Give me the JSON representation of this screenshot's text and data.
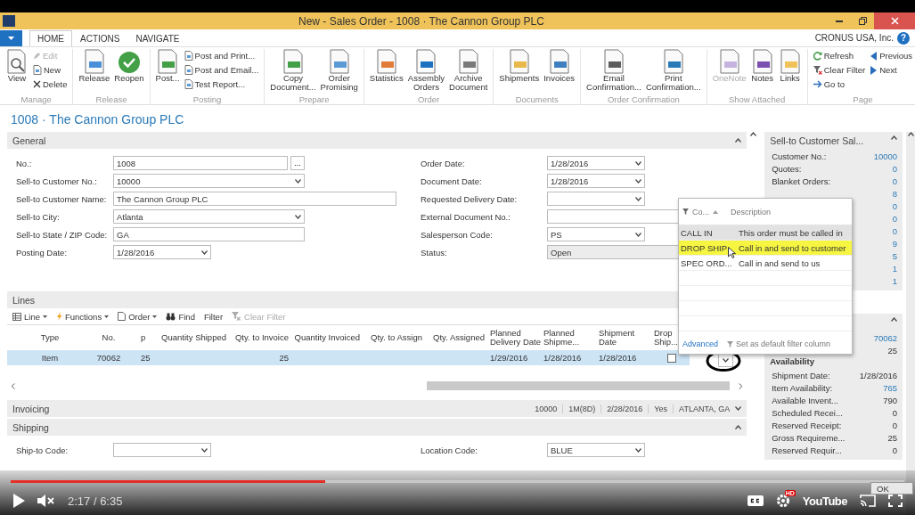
{
  "window": {
    "title": "New - Sales Order - 1008 · The Cannon Group PLC"
  },
  "ribbon": {
    "tabs": [
      {
        "label": "HOME",
        "selected": true
      },
      {
        "label": "ACTIONS",
        "selected": false
      },
      {
        "label": "NAVIGATE",
        "selected": false
      }
    ],
    "company": "CRONUS USA, Inc.",
    "help": "?",
    "groups": [
      {
        "label": "Manage",
        "items": [
          {
            "kind": "large",
            "label": "View",
            "disabled": false
          },
          {
            "kind": "small",
            "label": "Edit",
            "disabled": true
          },
          {
            "kind": "small",
            "label": "New",
            "disabled": false
          },
          {
            "kind": "small",
            "label": "Delete",
            "disabled": false
          }
        ]
      },
      {
        "label": "Release",
        "items": [
          {
            "kind": "large",
            "label": "Release",
            "disabled": false
          },
          {
            "kind": "large",
            "label": "Reopen",
            "disabled": false
          }
        ]
      },
      {
        "label": "Posting",
        "items": [
          {
            "kind": "large",
            "label": "Post...",
            "disabled": false
          },
          {
            "kind": "small",
            "label": "Post and Print...",
            "disabled": false
          },
          {
            "kind": "small",
            "label": "Post and Email...",
            "disabled": false
          },
          {
            "kind": "small",
            "label": "Test Report...",
            "disabled": false
          }
        ]
      },
      {
        "label": "Prepare",
        "items": [
          {
            "kind": "large",
            "label": "Copy\nDocument...",
            "disabled": false
          },
          {
            "kind": "large",
            "label": "Order\nPromising",
            "disabled": false
          }
        ]
      },
      {
        "label": "Order",
        "items": [
          {
            "kind": "large",
            "label": "Statistics",
            "disabled": false
          },
          {
            "kind": "large",
            "label": "Assembly\nOrders",
            "disabled": false
          },
          {
            "kind": "large",
            "label": "Archive\nDocument",
            "disabled": false
          }
        ]
      },
      {
        "label": "Documents",
        "items": [
          {
            "kind": "large",
            "label": "Shipments",
            "disabled": false
          },
          {
            "kind": "large",
            "label": "Invoices",
            "disabled": false
          }
        ]
      },
      {
        "label": "Order Confirmation",
        "items": [
          {
            "kind": "large",
            "label": "Email\nConfirmation...",
            "disabled": false
          },
          {
            "kind": "large",
            "label": "Print\nConfirmation...",
            "disabled": false
          }
        ]
      },
      {
        "label": "Show Attached",
        "items": [
          {
            "kind": "large",
            "label": "OneNote",
            "disabled": true
          },
          {
            "kind": "large",
            "label": "Notes",
            "disabled": false
          },
          {
            "kind": "large",
            "label": "Links",
            "disabled": false
          }
        ]
      },
      {
        "label": "Page",
        "items": [
          {
            "kind": "small",
            "label": "Refresh",
            "disabled": false
          },
          {
            "kind": "small",
            "label": "Clear Filter",
            "disabled": false
          },
          {
            "kind": "small",
            "label": "Go to",
            "disabled": false
          },
          {
            "kind": "small",
            "label": "Previous",
            "disabled": false
          },
          {
            "kind": "small",
            "label": "Next",
            "disabled": false
          }
        ]
      }
    ]
  },
  "page_title": "1008 · The Cannon Group PLC",
  "general": {
    "title": "General",
    "left_fields": [
      {
        "label": "No.:",
        "value": "1008",
        "kind": "lookup",
        "button": "..."
      },
      {
        "label": "Sell-to Customer No.:",
        "value": "10000",
        "kind": "dropdown"
      },
      {
        "label": "Sell-to Customer Name:",
        "value": "The Cannon Group PLC",
        "kind": "wide"
      },
      {
        "label": "Sell-to City:",
        "value": "Atlanta",
        "kind": "dropdown"
      },
      {
        "label": "Sell-to State / ZIP Code:",
        "value": "GA",
        "kind": "text"
      },
      {
        "label": "Posting Date:",
        "value": "1/28/2016",
        "kind": "date"
      }
    ],
    "right_fields": [
      {
        "label": "Order Date:",
        "value": "1/28/2016",
        "kind": "date"
      },
      {
        "label": "Document Date:",
        "value": "1/28/2016",
        "kind": "date"
      },
      {
        "label": "Requested Delivery Date:",
        "kind": "date"
      },
      {
        "label": "External Document No.:",
        "kind": "wide"
      },
      {
        "label": "Salesperson Code:",
        "value": "PS",
        "kind": "date"
      },
      {
        "label": "Status:",
        "value": "Open",
        "kind": "readonly"
      }
    ]
  },
  "lines": {
    "title": "Lines",
    "toolbar": [
      {
        "label": "Line",
        "menu": true,
        "disabled": false
      },
      {
        "label": "Functions",
        "menu": true,
        "disabled": false
      },
      {
        "label": "Order",
        "menu": true,
        "disabled": false
      },
      {
        "label": "Find",
        "menu": false,
        "disabled": false
      },
      {
        "label": "Filter",
        "menu": false,
        "disabled": false
      },
      {
        "label": "Clear Filter",
        "menu": false,
        "disabled": true
      }
    ],
    "columns": [
      {
        "label": "Type",
        "kind": "text"
      },
      {
        "label": "No.",
        "kind": "text"
      },
      {
        "label": "p",
        "kind": "cut"
      },
      {
        "label": "Quantity Shipped",
        "kind": "number"
      },
      {
        "label": "Qty. to Invoice",
        "kind": "number"
      },
      {
        "label": "Quantity Invoiced",
        "kind": "number"
      },
      {
        "label": "Qty. to Assign",
        "kind": "number"
      },
      {
        "label": "Qty. Assigned",
        "kind": "number"
      },
      {
        "label": "Planned Delivery Date",
        "kind": "date"
      },
      {
        "label": "Planned Shipme...",
        "kind": "date"
      },
      {
        "label": "Shipment Date",
        "kind": "date"
      },
      {
        "label": "Drop Ship...",
        "kind": "check"
      }
    ],
    "rows": [
      {
        "selected": true,
        "cells": [
          "Item",
          "70062",
          "25",
          null,
          "25",
          null,
          null,
          null,
          "1/29/2016",
          "1/28/2016",
          "1/28/2016",
          false
        ]
      }
    ]
  },
  "invoicing": {
    "title": "Invoicing",
    "summary": [
      "10000",
      "1M(8D)",
      "2/28/2016",
      "Yes",
      "ATLANTA, GA"
    ]
  },
  "shipping": {
    "title": "Shipping",
    "left_fields": [
      {
        "label": "Ship-to Code:",
        "kind": "date"
      }
    ],
    "right_fields": [
      {
        "label": "Location Code:",
        "value": "BLUE",
        "kind": "date"
      }
    ]
  },
  "lookup_popup": {
    "columns": [
      "Co...",
      "Description"
    ],
    "rows": [
      {
        "code": "CALL IN",
        "description": "This order must be called in",
        "selected": false,
        "focused": true
      },
      {
        "code": "DROP SHIP",
        "description": "Call in and send to customer",
        "selected": true,
        "focused": false
      },
      {
        "code": "SPEC ORD...",
        "description": "Call in and send to us",
        "selected": false,
        "focused": false
      }
    ],
    "advanced": "Advanced",
    "default_filter": "Set as default filter column"
  },
  "factboxes": [
    {
      "title": "Sell-to Customer Sal...",
      "rows": [
        {
          "label": "Customer No.:",
          "value": "10000",
          "link": true
        },
        {
          "label": "Quotes:",
          "value": "0",
          "link": true
        },
        {
          "label": "Blanket Orders:",
          "value": "0",
          "link": true
        },
        {
          "value": "8",
          "link": true
        },
        {
          "value": "0",
          "link": true
        },
        {
          "value": "0",
          "link": true
        },
        {
          "value": "0",
          "link": true
        },
        {
          "value": "9",
          "link": true
        },
        {
          "value": "5",
          "link": true
        },
        {
          "value": "1",
          "link": true
        },
        {
          "value": "1",
          "link": true
        }
      ]
    },
    {
      "rows": [
        {
          "value": "70062",
          "link": true
        },
        {
          "value": "25",
          "link": false
        },
        {
          "kind": "heading",
          "label": "Availability"
        },
        {
          "label": "Shipment Date:",
          "value": "1/28/2016",
          "link": false
        },
        {
          "label": "Item Availability:",
          "value": "765",
          "link": true
        },
        {
          "label": "Available Invent...",
          "value": "790",
          "link": false
        },
        {
          "label": "Scheduled Recei...",
          "value": "0",
          "link": false
        },
        {
          "label": "Reserved Receipt:",
          "value": "0",
          "link": false
        },
        {
          "label": "Gross Requireme...",
          "value": "25",
          "link": false
        },
        {
          "label": "Reserved Requir...",
          "value": "0",
          "link": false
        }
      ]
    }
  ],
  "ok_button": "OK",
  "player": {
    "progress": {
      "level": 0.352
    },
    "time": "2:17 / 6:35",
    "hd_badge": "HD",
    "logo": "YouTube"
  }
}
